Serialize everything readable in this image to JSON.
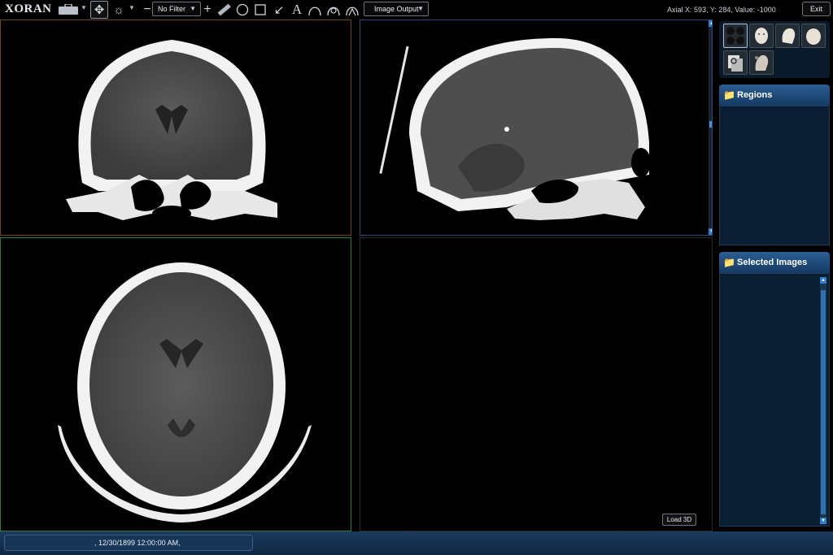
{
  "app": {
    "logo": "XORAN"
  },
  "toolbar": {
    "filter_select": "No Filter",
    "output_select": "Image Output",
    "readout": "Axial X: 593,  Y: 284,  Value: -1000",
    "exit_label": "Exit",
    "icons": [
      "toolbox-icon",
      "pan-icon",
      "brightness-icon",
      "zoom-out-icon",
      "zoom-in-icon",
      "ruler-icon",
      "ellipse-icon",
      "rectangle-icon",
      "arrow-icon",
      "text-icon",
      "curve-icon",
      "multi-curve-icon",
      "angle-curve-icon"
    ]
  },
  "viewports": {
    "coronal": {
      "view": "coronal"
    },
    "sagittal": {
      "view": "sagittal"
    },
    "axial": {
      "view": "axial"
    },
    "three_d": {
      "load_label": "Load 3D"
    }
  },
  "panel": {
    "regions_title": "Regions",
    "selected_title": "Selected Images",
    "thumbnails": [
      "multi-view-icon",
      "head-front-icon",
      "head-side-icon",
      "head-top-icon",
      "image-stack-icon",
      "head-profile-icon"
    ]
  },
  "statusbar": {
    "text": ", 12/30/1899 12:00:00 AM,"
  },
  "colors": {
    "accent": "#2f7fcf",
    "panel_header": "#1f4c7a",
    "coronal_border": "#6a4a2a",
    "axial_border": "#2f7a3a",
    "sagittal_border": "#2d4a78"
  }
}
